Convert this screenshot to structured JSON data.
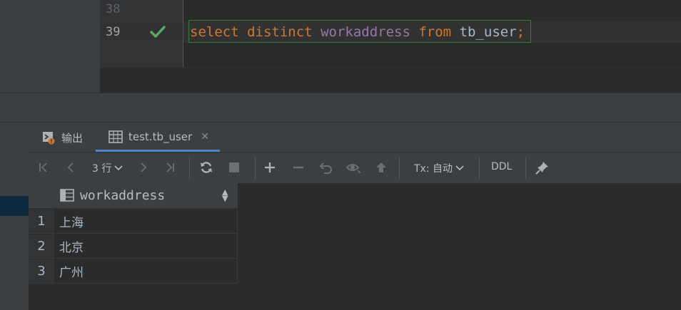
{
  "editor": {
    "line_numbers": [
      "38",
      "39"
    ],
    "code_tokens": [
      {
        "text": "select",
        "kind": "kw"
      },
      {
        "text": " ",
        "kind": "plain"
      },
      {
        "text": "distinct",
        "kind": "kw"
      },
      {
        "text": " ",
        "kind": "plain"
      },
      {
        "text": "workaddress",
        "kind": "id"
      },
      {
        "text": " ",
        "kind": "plain"
      },
      {
        "text": "from",
        "kind": "kw"
      },
      {
        "text": " ",
        "kind": "plain"
      },
      {
        "text": "tb_user",
        "kind": "plain"
      },
      {
        "text": ";",
        "kind": "semi"
      }
    ],
    "status_icon": "checkmark-icon",
    "check_color": "#59a869"
  },
  "tabs": {
    "output_label": "输出",
    "table_label": "test.tb_user",
    "close_glyph": "✕"
  },
  "toolbar": {
    "rows_label": "3 行",
    "tx_label": "Tx: 自动",
    "ddl_label": "DDL",
    "icons": [
      "first-page-icon",
      "prev-page-icon",
      "next-page-icon",
      "last-page-icon",
      "refresh-icon",
      "stop-icon",
      "add-row-icon",
      "delete-row-icon",
      "revert-icon",
      "preview-icon",
      "submit-icon",
      "pin-icon"
    ]
  },
  "grid": {
    "column": "workaddress",
    "rows": [
      {
        "num": "1",
        "value": "上海"
      },
      {
        "num": "2",
        "value": "北京"
      },
      {
        "num": "3",
        "value": "广州"
      }
    ]
  },
  "colors": {
    "accent": "#4a88c7",
    "keyword": "#cc7832",
    "identifier": "#9876aa",
    "text": "#a9b7c6"
  }
}
